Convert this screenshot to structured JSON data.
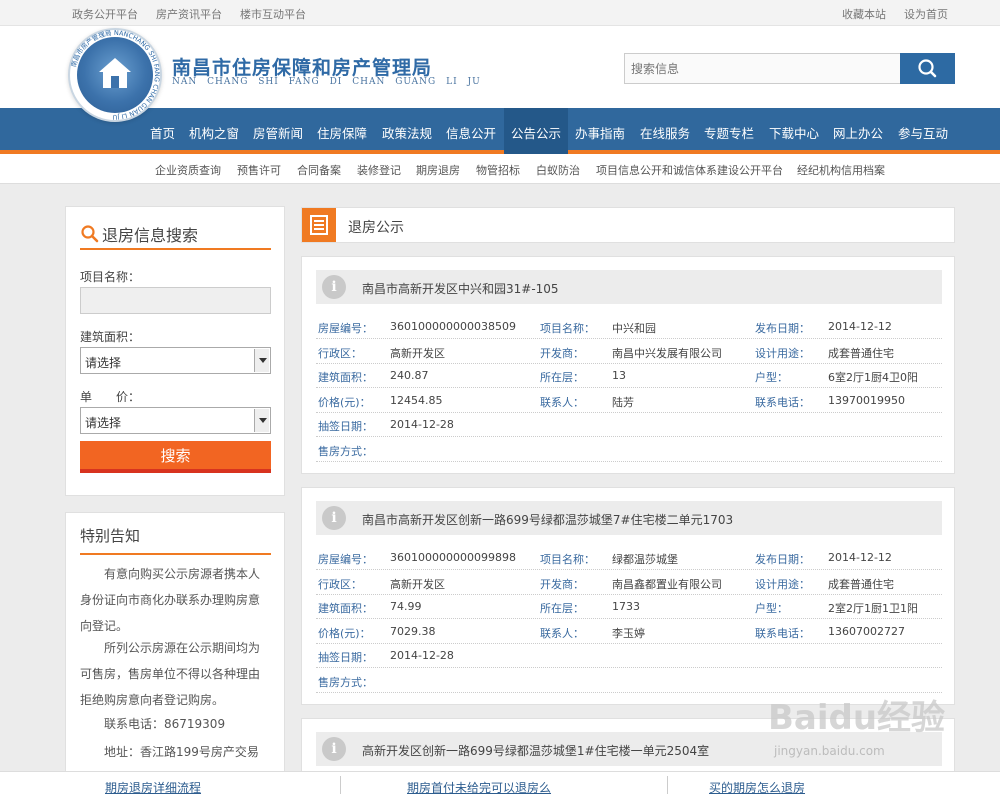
{
  "topbar": {
    "left_links": [
      "政务公开平台",
      "房产资讯平台",
      "楼市互动平台"
    ],
    "right_links": [
      "收藏本站",
      "设为首页"
    ]
  },
  "header": {
    "title": "南昌市住房保障和房产管理局",
    "subtitle": "NAN CHANG SHI FANG DI CHAN GUANG LI JU",
    "logo_text": "南昌市房产管理局 NANCHANG SHI FANG CHAN GUAN LI JU",
    "search_placeholder": "搜索信息"
  },
  "nav": {
    "items": [
      "首页",
      "机构之窗",
      "房管新闻",
      "住房保障",
      "政策法规",
      "信息公开",
      "公告公示",
      "办事指南",
      "在线服务",
      "专题专栏",
      "下载中心",
      "网上办公",
      "参与互动"
    ],
    "active": "公告公示"
  },
  "subnav": {
    "items": [
      "企业资质查询",
      "预售许可",
      "合同备案",
      "装修登记",
      "期房退房",
      "物管招标",
      "白蚁防治",
      "项目信息公开和诚信体系建设公开平台",
      "经纪机构信用档案"
    ]
  },
  "sidebar": {
    "search_title": "退房信息搜索",
    "project_label": "项目名称：",
    "area_label": "建筑面积：",
    "area_value": "请选择",
    "price_label": "单　　价：",
    "price_value": "请选择",
    "search_button": "搜索",
    "notice_title": "特别告知",
    "notice_p1": "有意向购买公示房源者携本人身份证向市商化办联系办理购房意向登记。",
    "notice_p2": "所列公示房源在公示期间均为可售房，售房单位不得以各种理由拒绝购房意向者登记购房。",
    "phone": "联系电话：86719309",
    "address": "地址：香江路199号房产交易"
  },
  "main": {
    "section_title": "退房公示",
    "cards": [
      {
        "title": "南昌市高新开发区中兴和园31#-105",
        "rows": [
          [
            [
              "房屋编号：",
              "360100000000038509"
            ],
            [
              "项目名称：",
              "中兴和园"
            ],
            [
              "发布日期：",
              "2014-12-12"
            ]
          ],
          [
            [
              "行政区：",
              "高新开发区"
            ],
            [
              "开发商：",
              "南昌中兴发展有限公司"
            ],
            [
              "设计用途：",
              "成套普通住宅"
            ]
          ],
          [
            [
              "建筑面积：",
              "240.87"
            ],
            [
              "所在层：",
              "13"
            ],
            [
              "户型：",
              "6室2厅1厨4卫0阳"
            ]
          ],
          [
            [
              "价格(元)：",
              "12454.85"
            ],
            [
              "联系人：",
              "陆芳"
            ],
            [
              "联系电话：",
              "13970019950"
            ]
          ],
          [
            [
              "抽签日期：",
              "2014-12-28"
            ]
          ],
          [
            [
              "售房方式：",
              ""
            ]
          ]
        ]
      },
      {
        "title": "南昌市高新开发区创新一路699号绿都温莎城堡7#住宅楼二单元1703",
        "rows": [
          [
            [
              "房屋编号：",
              "360100000000099898"
            ],
            [
              "项目名称：",
              "绿都温莎城堡"
            ],
            [
              "发布日期：",
              "2014-12-12"
            ]
          ],
          [
            [
              "行政区：",
              "高新开发区"
            ],
            [
              "开发商：",
              "南昌鑫都置业有限公司"
            ],
            [
              "设计用途：",
              "成套普通住宅"
            ]
          ],
          [
            [
              "建筑面积：",
              "74.99"
            ],
            [
              "所在层：",
              "1733"
            ],
            [
              "户型：",
              "2室2厅1厨1卫1阳"
            ]
          ],
          [
            [
              "价格(元)：",
              "7029.38"
            ],
            [
              "联系人：",
              "李玉婷"
            ],
            [
              "联系电话：",
              "13607002727"
            ]
          ],
          [
            [
              "抽签日期：",
              "2014-12-28"
            ]
          ],
          [
            [
              "售房方式：",
              ""
            ]
          ]
        ]
      },
      {
        "title": "高新开发区创新一路699号绿都温莎城堡1#住宅楼一单元2504室",
        "rows": []
      }
    ]
  },
  "bottombar": {
    "links": [
      "期房退房详细流程",
      "期房首付未给完可以退房么",
      "买的期房怎么退房"
    ]
  },
  "watermark": {
    "text": "Baidu经验",
    "url": "jingyan.baidu.com"
  }
}
